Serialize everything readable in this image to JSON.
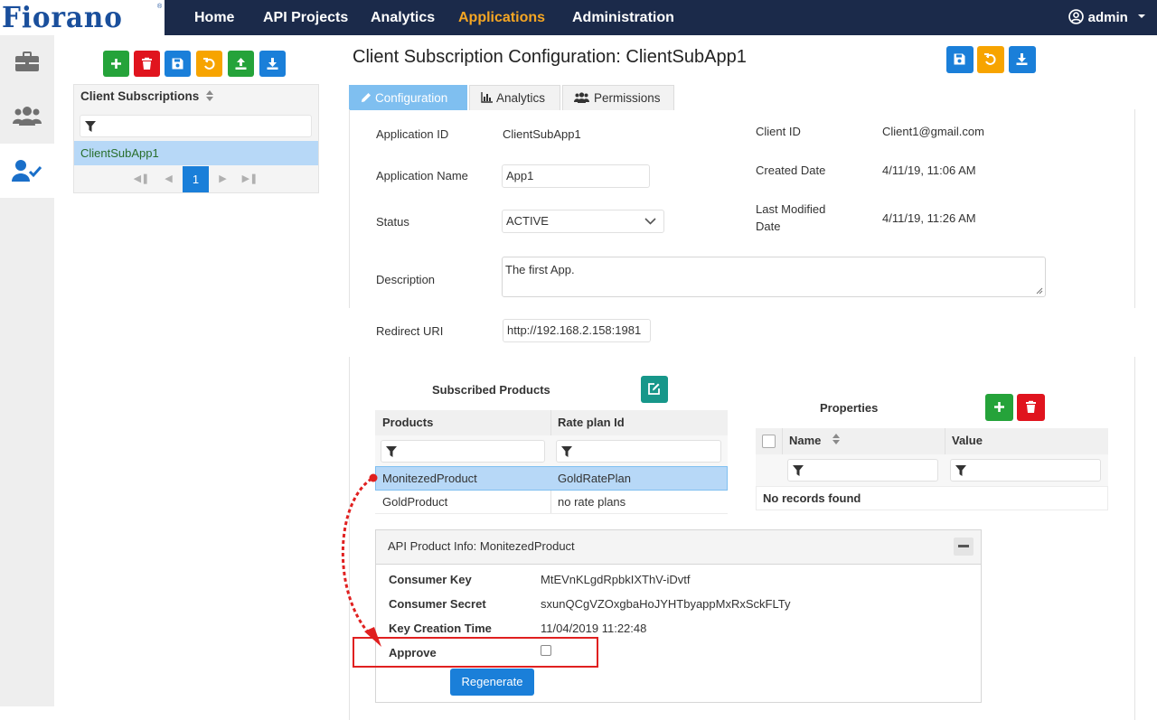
{
  "brand": {
    "logo_text": "Fiorano",
    "tm": "®"
  },
  "nav": {
    "home": "Home",
    "api_projects": "API Projects",
    "analytics": "Analytics",
    "applications": "Applications",
    "administration": "Administration",
    "user": "admin"
  },
  "rail": {
    "items": [
      "briefcase-icon",
      "users-icon",
      "user-check-icon"
    ],
    "selected": "user-check-icon"
  },
  "list": {
    "header": "Client Subscriptions",
    "items": [
      "ClientSubApp1"
    ],
    "page": "1"
  },
  "main": {
    "title": "Client Subscription Configuration: ClientSubApp1",
    "tabs": [
      "Configuration",
      "Analytics",
      "Permissions"
    ],
    "active_tab": "Configuration",
    "fields": {
      "application_id_label": "Application ID",
      "application_id": "ClientSubApp1",
      "application_name_label": "Application Name",
      "application_name": "App1",
      "status_label": "Status",
      "status": "ACTIVE",
      "description_label": "Description",
      "description": "The first App.",
      "redirect_uri_label": "Redirect URI",
      "redirect_uri": "http://192.168.2.158:1981",
      "client_id_label": "Client ID",
      "client_id": "Client1@gmail.com",
      "created_date_label": "Created Date",
      "created_date": "4/11/19, 11:06 AM",
      "last_modified_label_1": "Last Modified",
      "last_modified_label_2": "Date",
      "last_modified": "4/11/19, 11:26 AM"
    }
  },
  "subscribed": {
    "title": "Subscribed Products",
    "columns": [
      "Products",
      "Rate plan Id"
    ],
    "rows": [
      {
        "product": "MonitezedProduct",
        "plan": "GoldRatePlan"
      },
      {
        "product": "GoldProduct",
        "plan": "no rate plans"
      }
    ]
  },
  "properties": {
    "title": "Properties",
    "columns": [
      "Name",
      "Value"
    ],
    "empty": "No records found"
  },
  "product_info": {
    "title": "API Product Info: MonitezedProduct",
    "consumer_key_label": "Consumer Key",
    "consumer_key": "MtEVnKLgdRpbkIXThV-iDvtf",
    "consumer_secret_label": "Consumer Secret",
    "consumer_secret": "sxunQCgVZOxgbaHoJYHTbyappMxRxSckFLTy",
    "key_creation_label": "Key Creation Time",
    "key_creation": "11/04/2019 11:22:48",
    "approve_label": "Approve",
    "approved": false,
    "regenerate": "Regenerate"
  },
  "colors": {
    "nav_bg": "#1b2a4a",
    "accent": "#f5a623",
    "primary": "#1a7fd9",
    "add": "#25a33a",
    "delete": "#e0141e",
    "refresh": "#f7a400",
    "annotation": "#e02020"
  }
}
